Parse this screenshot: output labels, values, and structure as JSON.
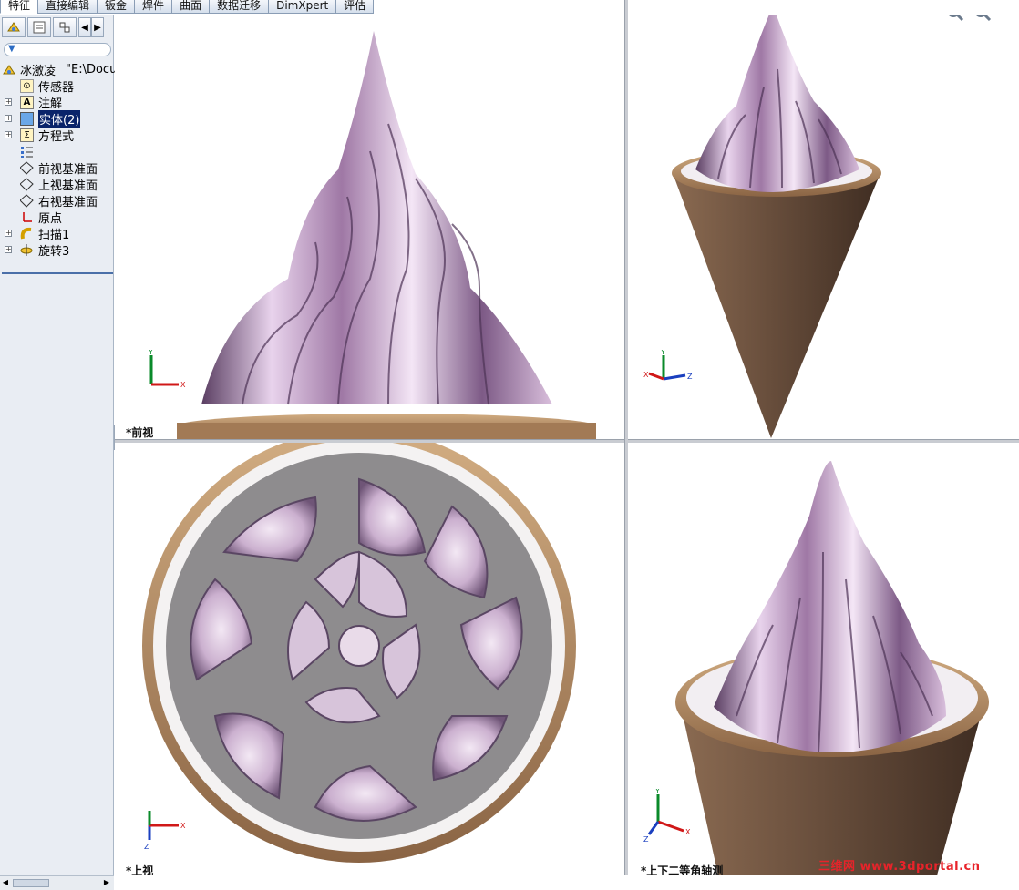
{
  "tabs": [
    "特征",
    "直接编辑",
    "钣金",
    "焊件",
    "曲面",
    "数据迁移",
    "DimXpert",
    "评估"
  ],
  "active_tab": "特征",
  "panel_tab_icons": [
    "feature-manager-icon",
    "property-manager-icon",
    "configuration-manager-icon"
  ],
  "tree": {
    "root_label": "冰激凌",
    "root_path": "\"E:\\Docu",
    "items": [
      {
        "label": "传感器",
        "icon": "sensor-icon",
        "expand": false
      },
      {
        "label": "注解",
        "icon": "annotation-icon",
        "expand": true
      },
      {
        "label": "实体(2)",
        "icon": "solid-bodies-icon",
        "expand": true,
        "selected": true
      },
      {
        "label": "方程式",
        "icon": "equation-icon",
        "expand": true
      },
      {
        "label": "",
        "icon": "material-icon",
        "expand": false
      },
      {
        "label": "前视基准面",
        "icon": "plane-icon",
        "expand": false
      },
      {
        "label": "上视基准面",
        "icon": "plane-icon",
        "expand": false
      },
      {
        "label": "右视基准面",
        "icon": "plane-icon",
        "expand": false
      },
      {
        "label": "原点",
        "icon": "origin-icon",
        "expand": false
      },
      {
        "label": "扫描1",
        "icon": "sweep-icon",
        "expand": true
      },
      {
        "label": "旋转3",
        "icon": "revolve-icon",
        "expand": true
      }
    ]
  },
  "viewports": {
    "front": {
      "label": "*前视"
    },
    "top": {
      "label": "*上视"
    },
    "isometric": {
      "label": "*上下二等角轴测"
    }
  },
  "axes": {
    "x": "X",
    "y": "Y",
    "z": "Z"
  },
  "zoom_icons": [
    "zoom-out-icon",
    "zoom-to-area-icon"
  ],
  "watermark": "三维网 www.3dportal.cn",
  "colors": {
    "swirl_light": "#f1e2f4",
    "swirl_mid": "#c7a3c9",
    "swirl_dark": "#5b3f63",
    "cone": "#6e5340",
    "rim": "#b58a5e",
    "selection": "#0a246a"
  }
}
